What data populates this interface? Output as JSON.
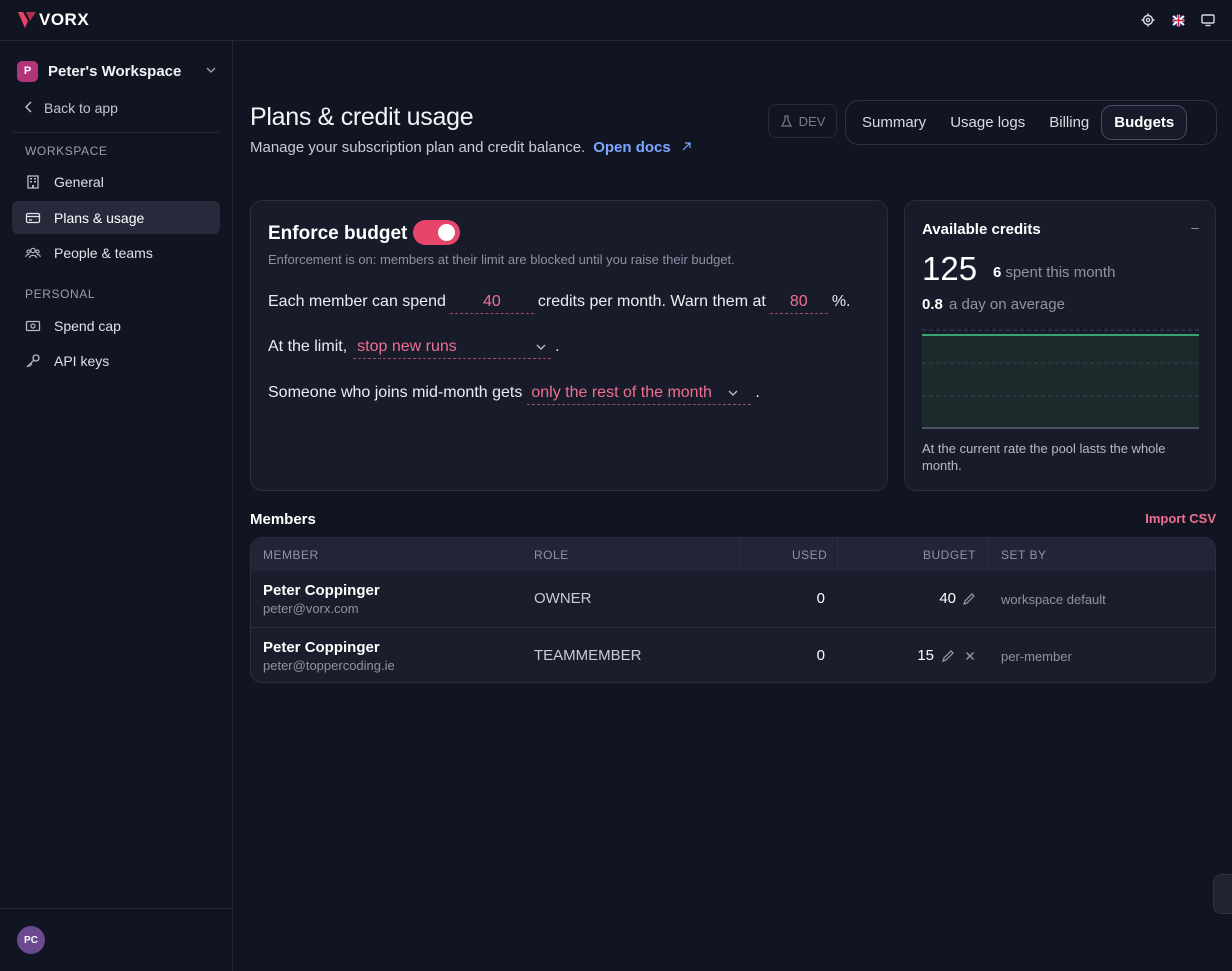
{
  "brand": {
    "logo_text": "VORX",
    "accent": "#e8456a"
  },
  "topbar": {
    "icons": [
      "gear-icon",
      "flag-icon",
      "monitor-icon"
    ]
  },
  "sidebar": {
    "workspace": {
      "avatar": "P",
      "name": "Peter's Workspace"
    },
    "back_label": "Back to app",
    "section_workspace": "WORKSPACE",
    "section_personal": "PERSONAL",
    "items": [
      {
        "label": "General",
        "icon": "building-icon",
        "active": false
      },
      {
        "label": "Plans & usage",
        "icon": "credit-card-icon",
        "active": true
      },
      {
        "label": "People & teams",
        "icon": "people-icon",
        "active": false
      },
      {
        "label": "Spend cap",
        "icon": "cash-icon",
        "active": false
      },
      {
        "label": "API keys",
        "icon": "key-icon",
        "active": false
      }
    ],
    "user_initials": "PC"
  },
  "header": {
    "title": "Plans & credit usage",
    "subtitle": "Manage your subscription plan and credit balance.",
    "docs_link": "Open docs",
    "dev_badge": "DEV",
    "tabs": [
      {
        "label": "Summary",
        "active": false
      },
      {
        "label": "Usage logs",
        "active": false
      },
      {
        "label": "Billing",
        "active": false
      },
      {
        "label": "Budgets",
        "active": true
      }
    ]
  },
  "budget": {
    "title": "Enforce budget",
    "enabled": true,
    "description": "Enforcement is on: members at their limit are blocked until you raise their budget.",
    "line1_a": "Each member can spend",
    "spend_value": "40",
    "line1_b": "credits per month. Warn them at",
    "warn_value": "80",
    "line1_c": "%.",
    "line2_a": "At the limit,",
    "limit_action": "stop new runs",
    "period": ".",
    "line3_a": "Someone who joins mid-month gets",
    "join_policy": "only the rest of the month"
  },
  "credits": {
    "title": "Available credits",
    "dash": "–",
    "available": "125",
    "spent": "6",
    "spent_label": "spent this month",
    "avg": "0.8",
    "avg_label": "a day on average",
    "note": "At the current rate the pool lasts the whole month.",
    "line_color": "#3ecf8e"
  },
  "members": {
    "label": "Members",
    "import_label": "Import CSV",
    "columns": [
      "MEMBER",
      "ROLE",
      "USED",
      "BUDGET",
      "SET BY"
    ],
    "rows": [
      {
        "name": "Peter Coppinger",
        "email": "peter@vorx.com",
        "role": "OWNER",
        "used": "0",
        "budget": "40",
        "set_by": "workspace default"
      },
      {
        "name": "Peter Coppinger",
        "email": "peter@toppercoding.ie",
        "role": "TEAMMEMBER",
        "used": "0",
        "budget": "15",
        "set_by": "per-member"
      }
    ]
  }
}
